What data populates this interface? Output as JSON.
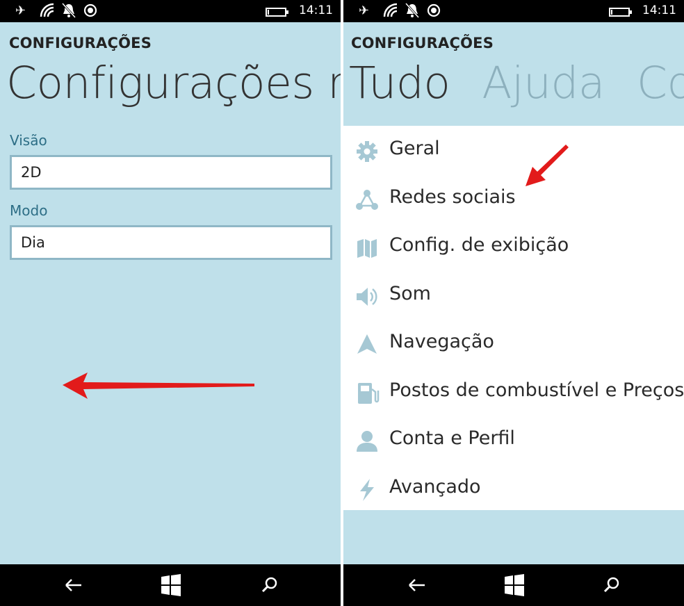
{
  "colors": {
    "app_background": "#bfe0ea",
    "panel_background": "#ffffff",
    "accent_label": "#2d6e86",
    "icon_blue": "#a6c8d4",
    "annotation_arrow": "#e21b1b",
    "bar_black": "#000000"
  },
  "left_screen": {
    "status_bar": {
      "icons": [
        "airplane-icon",
        "wifi-icon",
        "quiet-hours-icon",
        "location-icon"
      ],
      "battery_level": 0.1,
      "time": "14:11"
    },
    "app_title": "CONFIGURAÇÕES",
    "pivot_title": "Configurações rá",
    "fields": [
      {
        "label": "Visão",
        "value": "2D"
      },
      {
        "label": "Modo",
        "value": "Dia"
      }
    ],
    "nav_bar": {
      "buttons": [
        "back-icon",
        "windows-start-icon",
        "search-icon"
      ]
    }
  },
  "right_screen": {
    "status_bar": {
      "icons": [
        "airplane-icon",
        "wifi-icon",
        "quiet-hours-icon",
        "location-icon"
      ],
      "battery_level": 0.1,
      "time": "14:11"
    },
    "app_title": "CONFIGURAÇÕES",
    "pivot_tabs": [
      {
        "label": "Tudo",
        "active": true
      },
      {
        "label": "Ajuda",
        "active": false
      },
      {
        "label": "Co",
        "active": false
      }
    ],
    "menu_items": [
      {
        "label": "Geral",
        "icon": "gear-icon"
      },
      {
        "label": "Redes sociais",
        "icon": "share-network-icon"
      },
      {
        "label": "Config. de exibição",
        "icon": "map-icon"
      },
      {
        "label": "Som",
        "icon": "speaker-icon"
      },
      {
        "label": "Navegação",
        "icon": "navigation-arrow-icon"
      },
      {
        "label": "Postos de combustível e Preços",
        "icon": "fuel-pump-icon"
      },
      {
        "label": "Conta e Perfil",
        "icon": "person-icon"
      },
      {
        "label": "Avançado",
        "icon": "lightning-icon"
      }
    ],
    "nav_bar": {
      "buttons": [
        "back-icon",
        "windows-start-icon",
        "search-icon"
      ]
    }
  }
}
